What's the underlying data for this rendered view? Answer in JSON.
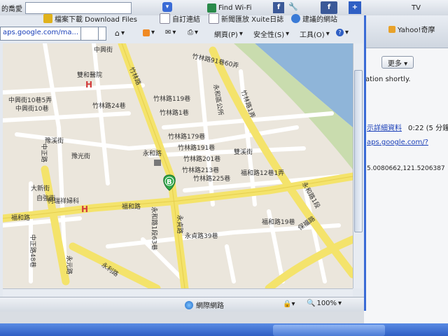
{
  "bookmarks": {
    "left_label": "的喬愛",
    "items": [
      {
        "label": "檔案下載 Download Files",
        "icon": "star-icon"
      },
      {
        "label": "自訂連結",
        "icon": "page-icon"
      },
      {
        "label": "新聞匯放 Xuite日誌",
        "icon": "page-icon"
      },
      {
        "label": "建議的網站",
        "icon": "ie-icon"
      }
    ],
    "find_wifi": "Find Wi-Fi",
    "tv_label": "TV"
  },
  "back_window": {
    "yahoo_label": "Yahoo!奇摩",
    "more_button": "更多 ▾",
    "text_shortly": "ation shortly.",
    "detail_link": "示詳細資料",
    "time_text": "0:22 (5 分鐘",
    "maps_link": "aps.google.com/?",
    "coords": "5.0080662,121.5206387"
  },
  "main_window": {
    "address_text": "aps.google.com/ma...",
    "commands": {
      "page": "網頁(P)",
      "safety": "安全性(S)",
      "tools": "工具(O)"
    }
  },
  "map": {
    "marker_letter": "B",
    "hospital_symbol": "H",
    "labels": [
      "中興街",
      "竹林路",
      "竹林路91巷60弄",
      "竹林路119巷",
      "竹林路24巷",
      "中興街10巷5弄",
      "中興街10巷",
      "豫溪街",
      "竹林路179巷",
      "竹林路191巷",
      "竹林路201巷",
      "竹林路213巷",
      "竹林路225巷",
      "永和路",
      "福和路",
      "福和路12巷1弄",
      "大新街",
      "自強街",
      "柯瑞祥婦科",
      "福和路",
      "永貞路",
      "永貞路39巷",
      "永和路1段63巷",
      "永利路",
      "竹林路1巷",
      "豫光街",
      "雙溪街",
      "中正路",
      "保福路",
      "永和路1段",
      "福和路19巷",
      "中正路48巷",
      "永元路",
      "竹林路1弄",
      "雙和醫院",
      "永和區公所"
    ]
  },
  "status": {
    "zone": "網際網路",
    "zoom": "100%"
  },
  "colors": {
    "road_yellow": "#f4e36b",
    "road_white": "#ffffff",
    "land": "#ebe6dc",
    "water": "#8fb5d9",
    "park": "#c9dcae",
    "window_border": "#3a6bd6"
  }
}
